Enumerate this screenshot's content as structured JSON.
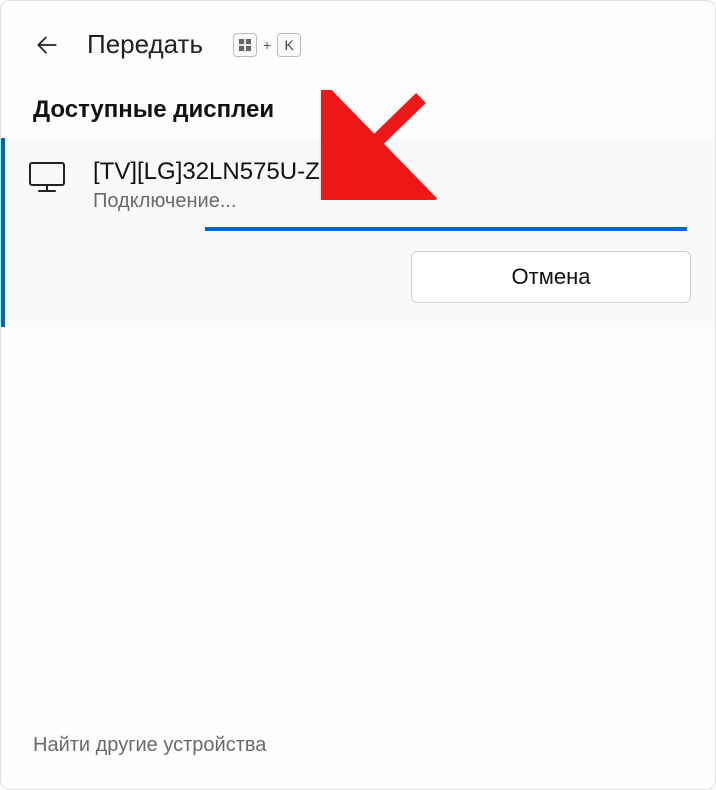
{
  "header": {
    "title": "Передать",
    "shortcut_key2": "K"
  },
  "section_title": "Доступные дисплеи",
  "device": {
    "name": "[TV][LG]32LN575U-ZE",
    "status": "Подключение...",
    "cancel_label": "Отмена"
  },
  "footer_link": "Найти другие устройства",
  "colors": {
    "accent": "#0067c0",
    "annotation": "#ef1818"
  }
}
